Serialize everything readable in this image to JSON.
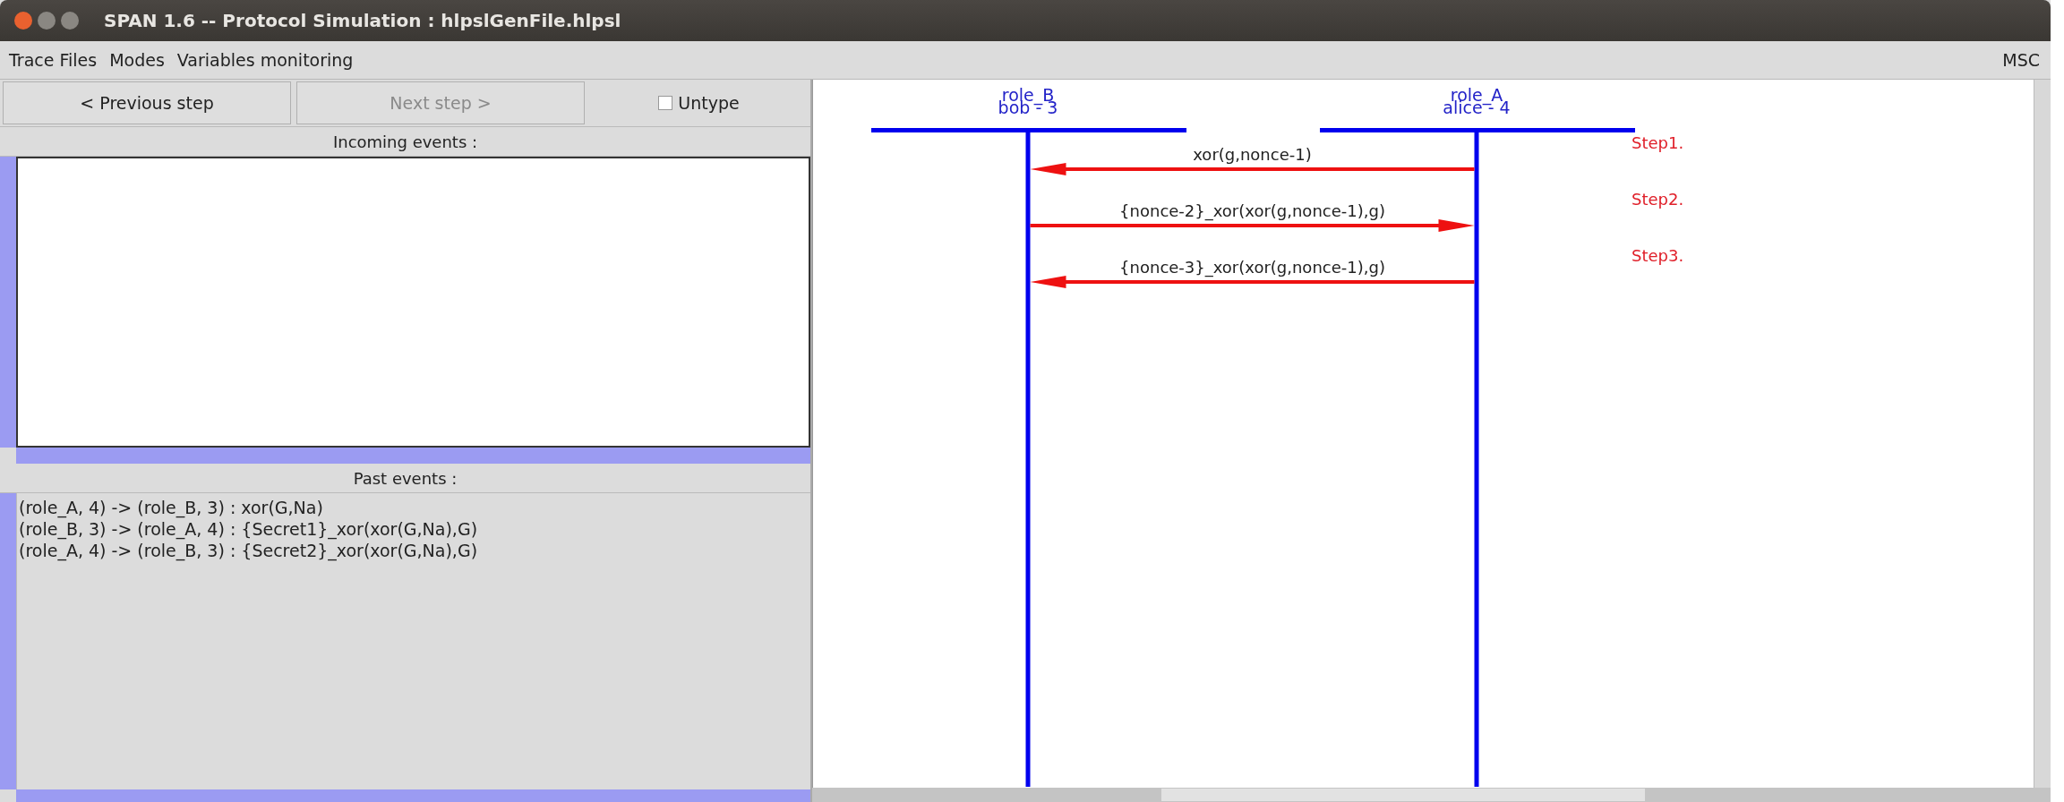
{
  "window": {
    "title": "SPAN 1.6 -- Protocol Simulation : hlpslGenFile.hlpsl"
  },
  "menu": {
    "items": [
      "Trace Files",
      "Modes",
      "Variables monitoring"
    ],
    "right": "MSC"
  },
  "toolbar": {
    "buttons": [
      {
        "label": "< Previous step",
        "disabled": false
      },
      {
        "label": "Next step >",
        "disabled": true
      }
    ],
    "untype": {
      "label": "Untype",
      "checked": false
    }
  },
  "incoming_events": {
    "title": "Incoming events :"
  },
  "past_events": {
    "title": "Past events :",
    "items": [
      "(role_A, 4) -> (role_B, 3) : xor(G,Na)",
      "(role_B, 3) -> (role_A, 4) : {Secret1}_xor(xor(G,Na),G)",
      "(role_A, 4) -> (role_B, 3) : {Secret2}_xor(xor(G,Na),G)"
    ]
  },
  "msc": {
    "roles": [
      {
        "name": "role_B",
        "instance": "bob - 3"
      },
      {
        "name": "role_A",
        "instance": "alice - 4"
      }
    ],
    "messages": [
      {
        "label": "xor(g,nonce-1)",
        "kind": "leftward",
        "step": "Step1."
      },
      {
        "label": "{nonce-2}_xor(xor(g,nonce-1),g)",
        "kind": "rightward",
        "step": "Step2."
      },
      {
        "label": "{nonce-3}_xor(xor(g,nonce-1),g)",
        "kind": "leftward",
        "step": "Step3."
      }
    ]
  }
}
